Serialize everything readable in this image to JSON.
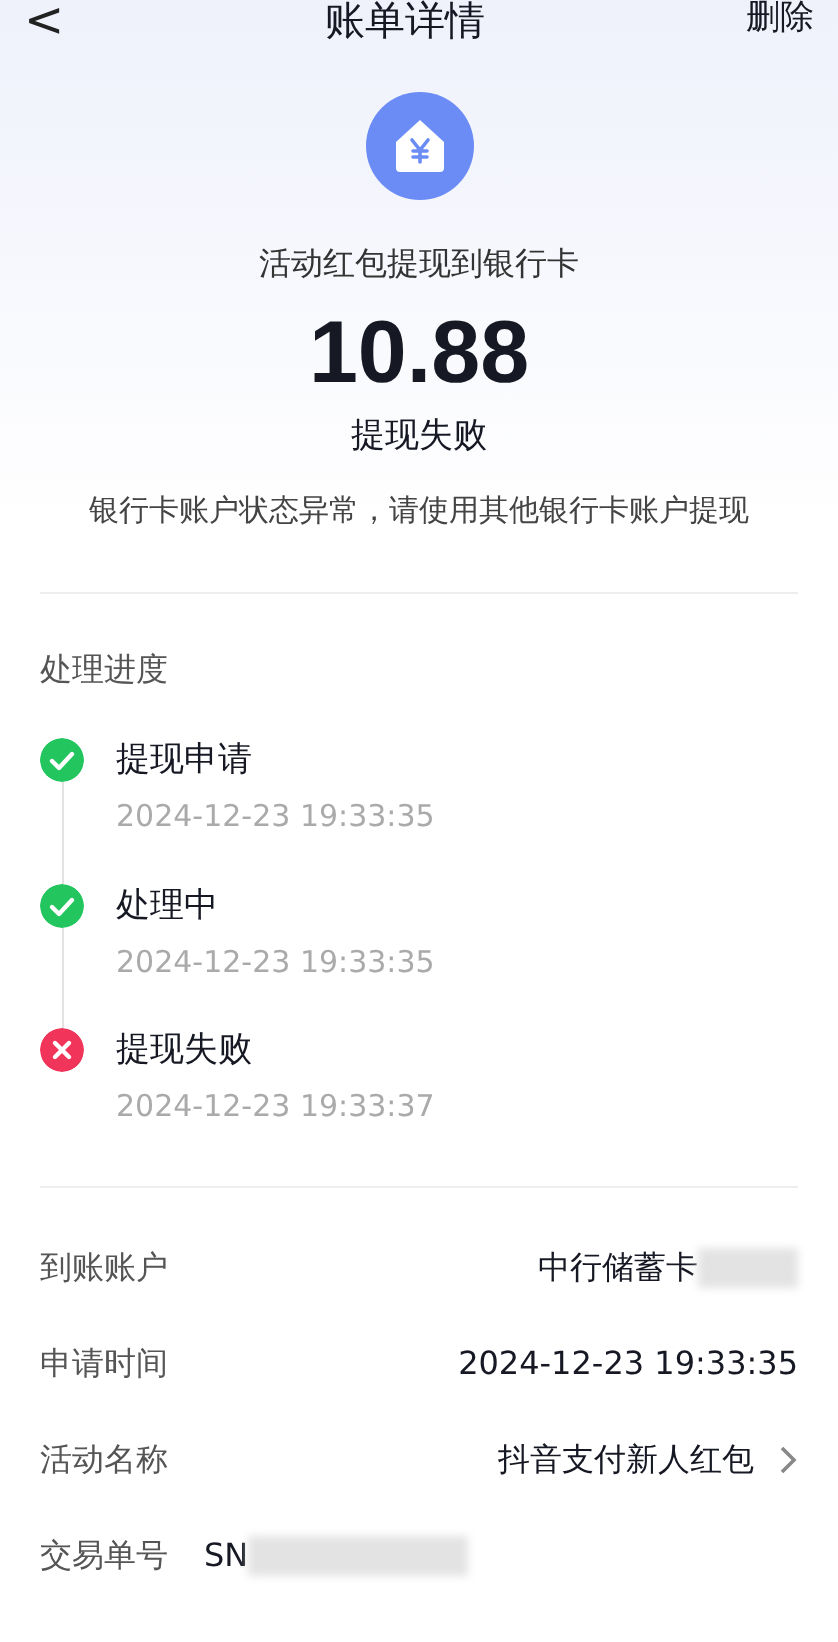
{
  "header": {
    "back": "<",
    "title": "账单详情",
    "action": "删除"
  },
  "summary": {
    "subtitle": "活动红包提现到银行卡",
    "amount": "10.88",
    "status": "提现失败",
    "message": "银行卡账户状态异常，请使用其他银行卡账户提现"
  },
  "progress": {
    "title": "处理进度",
    "steps": [
      {
        "label": "提现申请",
        "time": "2024-12-23 19:33:35",
        "kind": "success"
      },
      {
        "label": "处理中",
        "time": "2024-12-23 19:33:35",
        "kind": "success"
      },
      {
        "label": "提现失败",
        "time": "2024-12-23 19:33:37",
        "kind": "failure"
      }
    ]
  },
  "details": [
    {
      "label": "到账账户",
      "value": "中行储蓄卡",
      "redacted": true,
      "link": false,
      "kind": "spread"
    },
    {
      "label": "申请时间",
      "value": "2024-12-23 19:33:35",
      "redacted": false,
      "link": false,
      "kind": "spread"
    },
    {
      "label": "活动名称",
      "value": "抖音支付新人红包",
      "redacted": false,
      "link": true,
      "kind": "spread"
    },
    {
      "label": "交易单号",
      "value": "SN",
      "redacted": true,
      "link": false,
      "kind": "inline"
    }
  ]
}
